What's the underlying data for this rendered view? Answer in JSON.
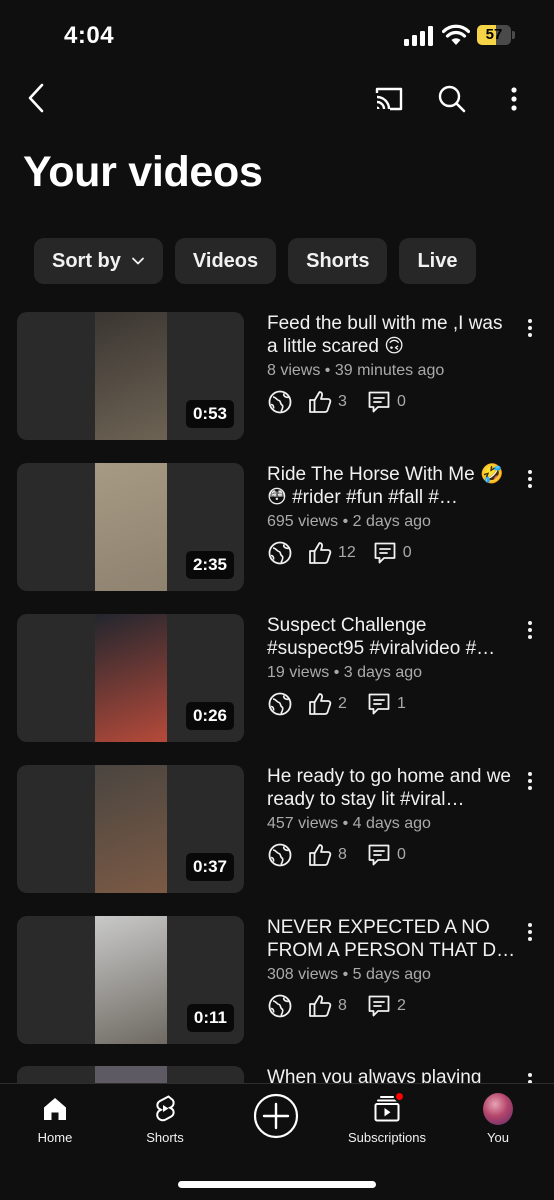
{
  "status_bar": {
    "time": "4:04",
    "battery": "57",
    "battery_level": 0.57
  },
  "header": {
    "title": "Your videos"
  },
  "filters": [
    "Sort by",
    "Videos",
    "Shorts",
    "Live"
  ],
  "videos": [
    {
      "title": "Feed the bull with me ,I was a little scared 🙃",
      "meta": "8 views • 39 minutes ago",
      "duration": "0:53",
      "likes": "3",
      "comments": "0",
      "thumb_colors": [
        "#3b3632",
        "#6d6354"
      ]
    },
    {
      "title": "Ride The Horse With Me 🤣😳 #rider #fun #fall #…",
      "meta": "695 views • 2 days ago",
      "duration": "2:35",
      "likes": "12",
      "comments": "0",
      "thumb_colors": [
        "#a79a84",
        "#8e8270"
      ]
    },
    {
      "title": "Suspect Challenge #suspect95 #viralvideo #…",
      "meta": "19 views • 3 days ago",
      "duration": "0:26",
      "likes": "2",
      "comments": "1",
      "thumb_colors": [
        "#22262e",
        "#b64a3a"
      ]
    },
    {
      "title": "He ready to go home and we ready to stay lit #viral…",
      "meta": "457 views • 4 days ago",
      "duration": "0:37",
      "likes": "8",
      "comments": "0",
      "thumb_colors": [
        "#4a4540",
        "#7b5a45"
      ]
    },
    {
      "title": "NEVER EXPECTED A NO FROM A PERSON THAT D…",
      "meta": "308 views • 5 days ago",
      "duration": "0:11",
      "likes": "8",
      "comments": "2",
      "thumb_colors": [
        "#c9c9c9",
        "#6e6a62"
      ]
    }
  ],
  "partial_video": {
    "title": "When you always playing"
  },
  "nav": {
    "home": "Home",
    "shorts": "Shorts",
    "subscriptions": "Subscriptions",
    "you": "You"
  },
  "colors": {
    "background": "#0f0f0f",
    "chip": "#272727",
    "secondary_text": "#aaaaaa",
    "battery": "#f5d547",
    "notification": "#ff0000"
  }
}
